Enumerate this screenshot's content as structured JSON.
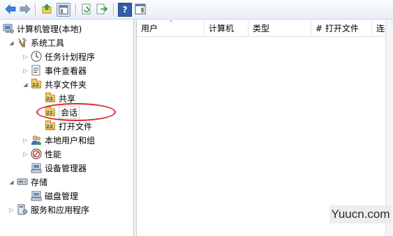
{
  "toolbar": {
    "buttons": [
      "back-icon",
      "forward-icon",
      "up-icon",
      "show-hide-tree-icon",
      "refresh-icon",
      "export-icon",
      "help-icon",
      "show-hide-action-icon"
    ]
  },
  "tree": {
    "items": [
      {
        "label": "计算机管理(本地)",
        "icon": "computer-management-icon"
      },
      {
        "label": "系统工具",
        "icon": "system-tools-icon"
      },
      {
        "label": "任务计划程序",
        "icon": "clock-icon"
      },
      {
        "label": "事件查看器",
        "icon": "event-viewer-icon"
      },
      {
        "label": "共享文件夹",
        "icon": "shared-folder-icon"
      },
      {
        "label": "共享",
        "icon": "shared-folder-icon"
      },
      {
        "label": "会话",
        "icon": "shared-folder-icon"
      },
      {
        "label": "打开文件",
        "icon": "shared-folder-icon"
      },
      {
        "label": "本地用户和组",
        "icon": "users-icon"
      },
      {
        "label": "性能",
        "icon": "performance-icon"
      },
      {
        "label": "设备管理器",
        "icon": "device-manager-icon"
      },
      {
        "label": "存储",
        "icon": "storage-icon"
      },
      {
        "label": "磁盘管理",
        "icon": "disk-management-icon"
      },
      {
        "label": "服务和应用程序",
        "icon": "services-icon"
      }
    ]
  },
  "list": {
    "columns": [
      "用户",
      "计算机",
      "类型",
      "# 打开文件",
      "连接"
    ]
  },
  "watermark": "Yuucn.com",
  "colors": {
    "highlight_ellipse": "#d42a2a",
    "toolbar_bg": "#e9eff7"
  }
}
